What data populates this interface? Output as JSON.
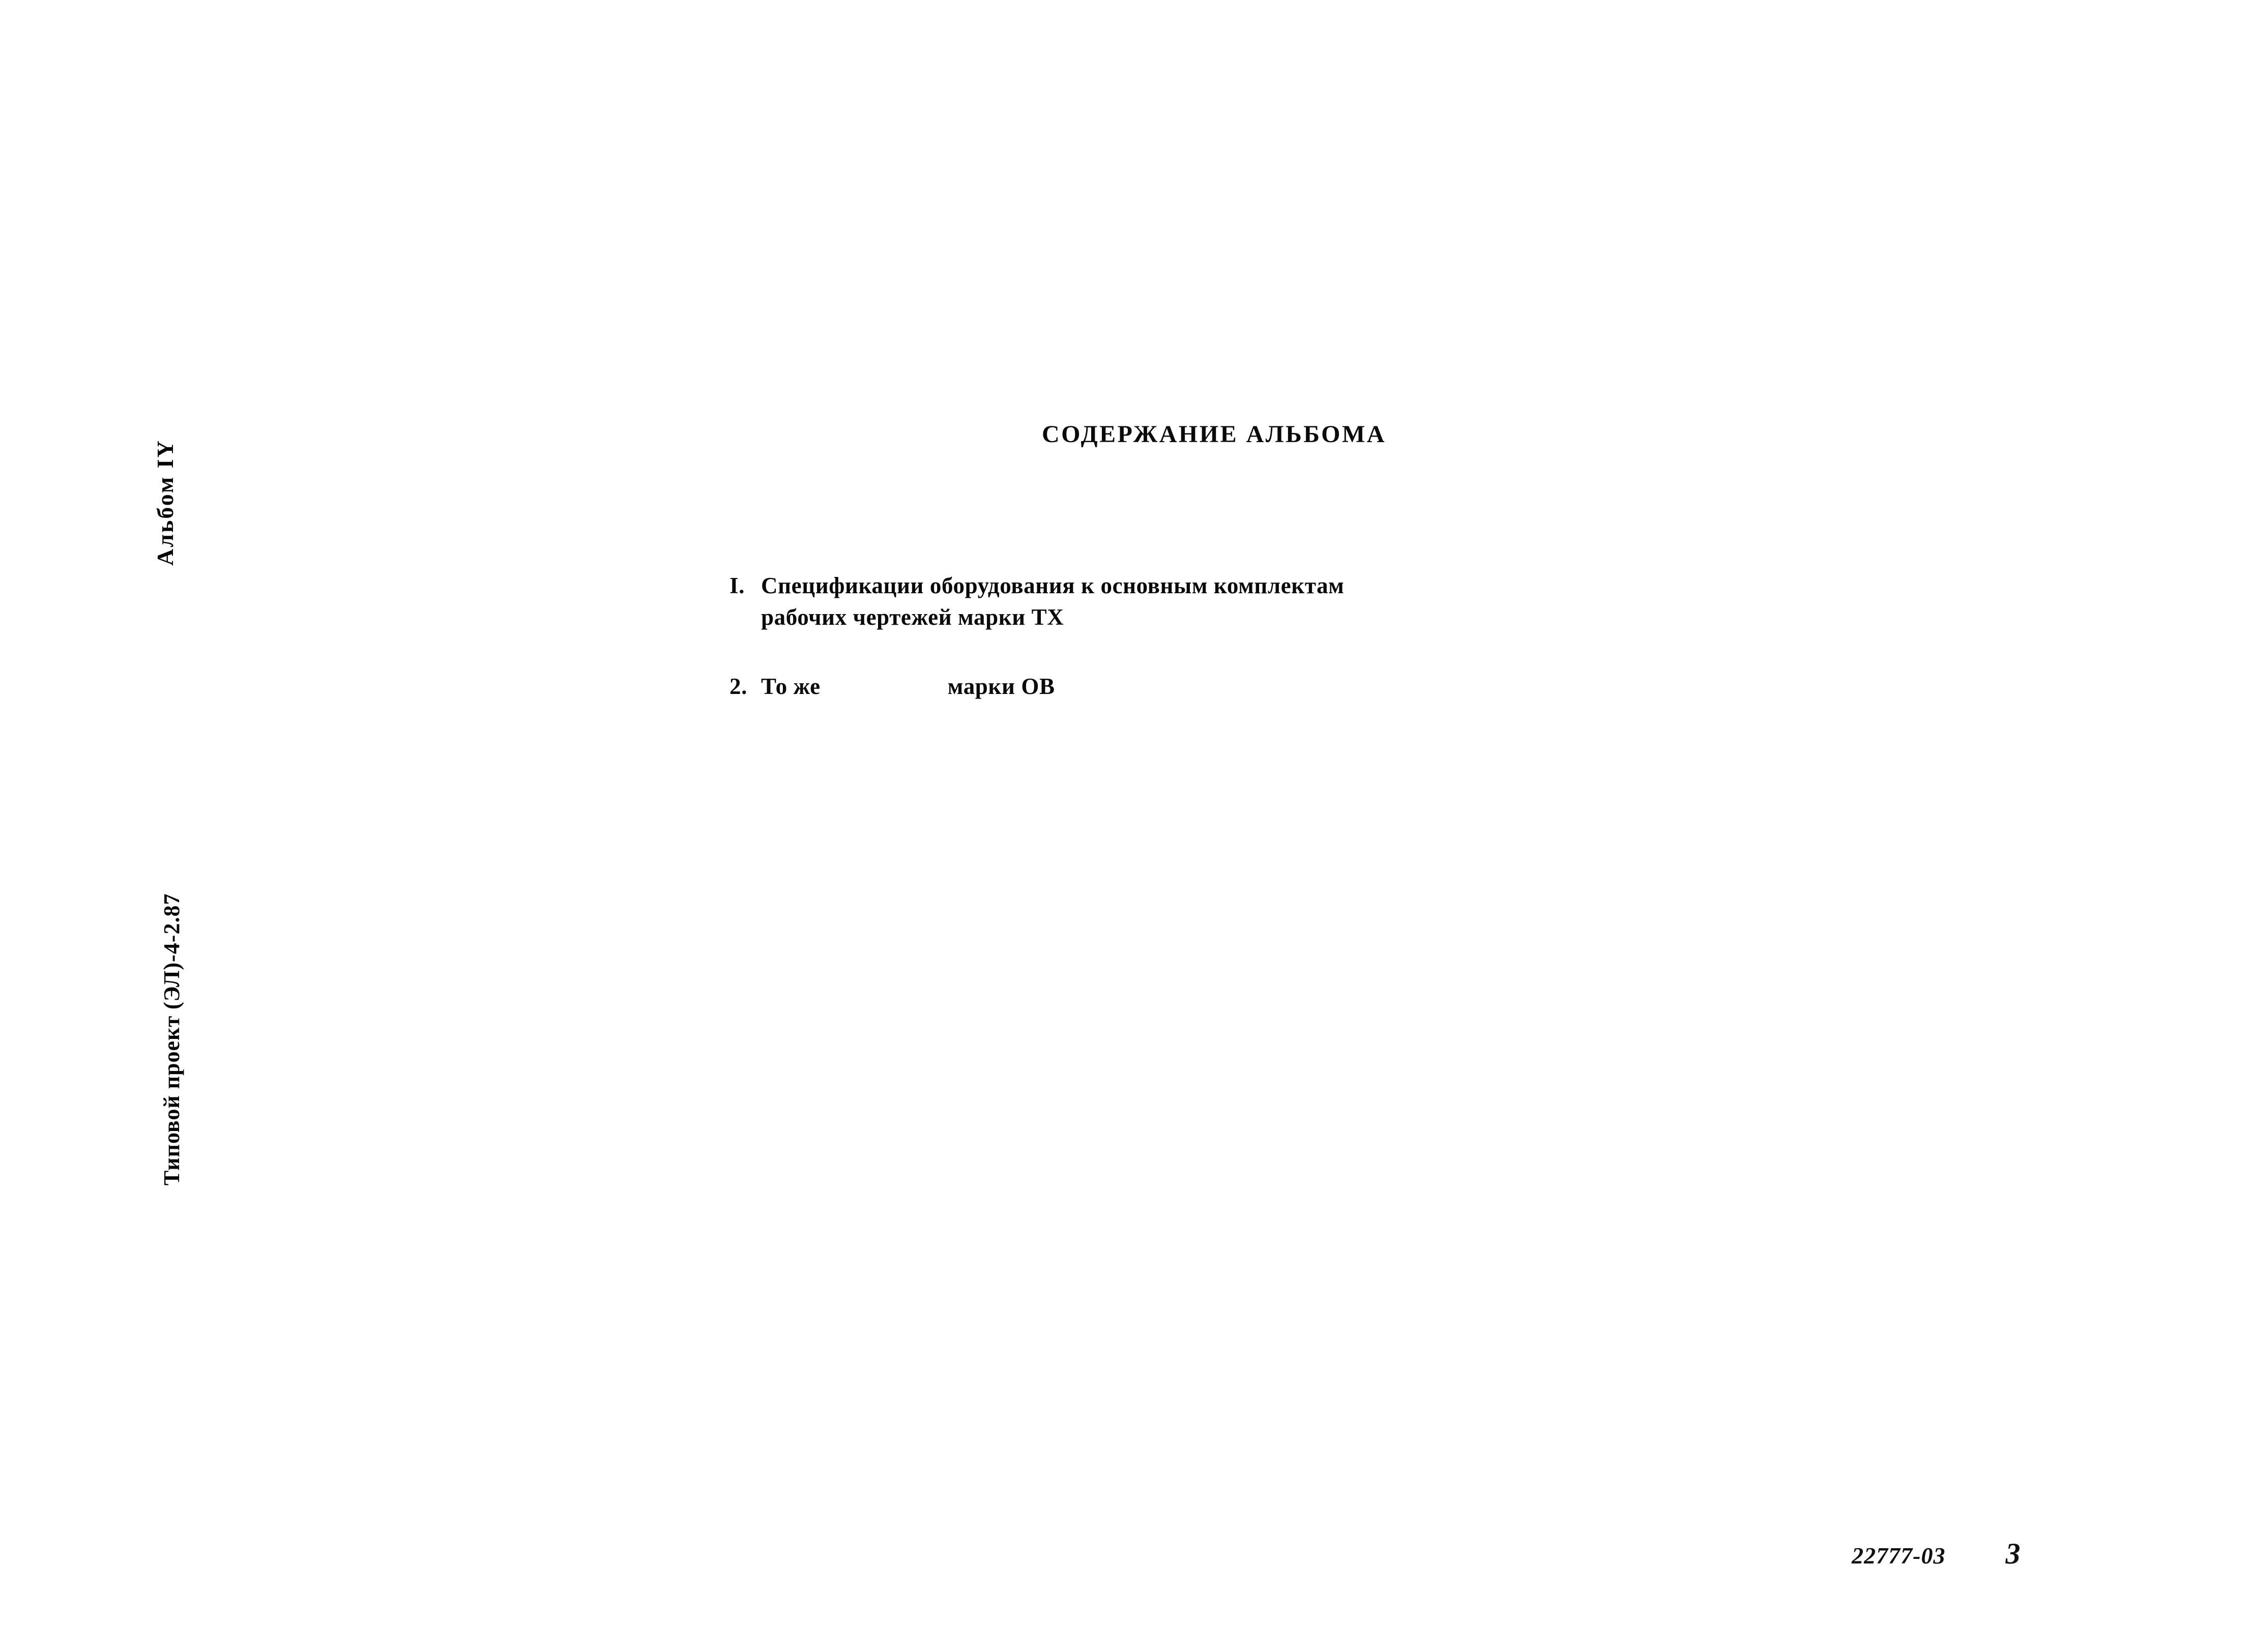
{
  "document": {
    "kind": "scanned-typewritten-page",
    "language": "ru",
    "background_color": "#ffffff",
    "ink_color": "#0a0a0a"
  },
  "margin": {
    "album_label": "Альбом IY",
    "project_label": "Типовой проект (ЭЛ)-4-2.87"
  },
  "heading": {
    "title": "СОДЕРЖАНИЕ АЛЬБОМА"
  },
  "contents": {
    "items": [
      {
        "number": "I.",
        "line1": "Спецификации оборудования к основным комплектам",
        "line2": "рабочих чертежей марки ТХ"
      },
      {
        "number": "2.",
        "line1": "То же",
        "tail": "марки ОВ"
      }
    ]
  },
  "footer": {
    "doc_number": "22777-03",
    "page_number": "3"
  }
}
